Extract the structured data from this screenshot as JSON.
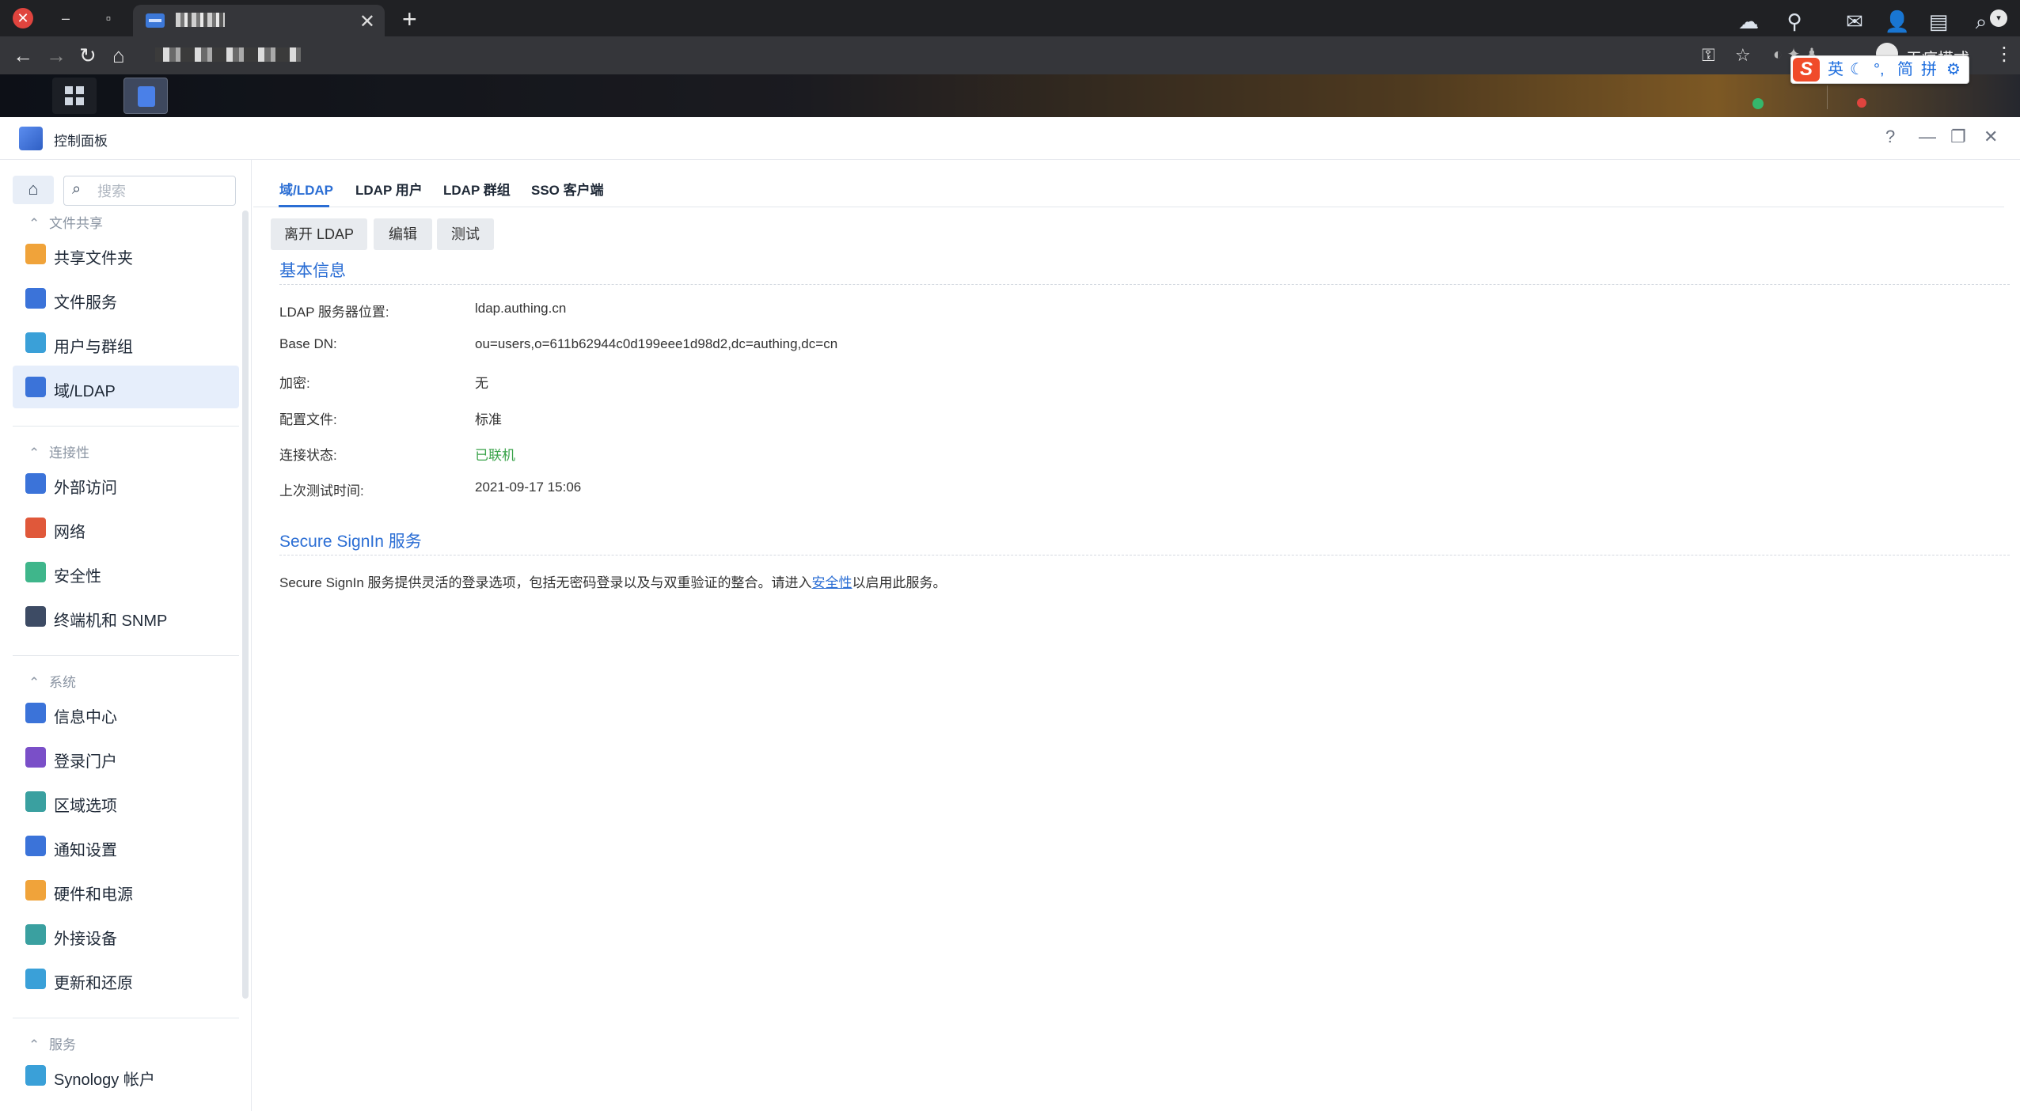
{
  "browser": {
    "tab_close": "✕",
    "new_tab": "+",
    "profile_label": "无痕模式",
    "menu": "⋮"
  },
  "ime": {
    "lang": "英",
    "moon": "☾",
    "punctuation": "°,",
    "simplified": "简",
    "pinyin": "拼",
    "settings": "⚙"
  },
  "window": {
    "title": "控制面板",
    "help": "?",
    "minimize": "—",
    "restore": "❐",
    "close": "✕"
  },
  "sidebar": {
    "search_placeholder": "搜索",
    "sections": [
      {
        "title": "文件共享",
        "items": [
          {
            "label": "共享文件夹",
            "icon": "shared-folder-icon",
            "color": "#f0a33a"
          },
          {
            "label": "文件服务",
            "icon": "file-services-icon",
            "color": "#3b73d9"
          },
          {
            "label": "用户与群组",
            "icon": "user-group-icon",
            "color": "#3aa0d8"
          },
          {
            "label": "域/LDAP",
            "icon": "domain-ldap-icon",
            "color": "#3b73d9",
            "active": true
          }
        ]
      },
      {
        "title": "连接性",
        "items": [
          {
            "label": "外部访问",
            "icon": "external-access-icon",
            "color": "#3b73d9"
          },
          {
            "label": "网络",
            "icon": "network-icon",
            "color": "#e0583a"
          },
          {
            "label": "安全性",
            "icon": "security-icon",
            "color": "#3fb68b"
          },
          {
            "label": "终端机和 SNMP",
            "icon": "terminal-icon",
            "color": "#3d4b64"
          }
        ]
      },
      {
        "title": "系统",
        "items": [
          {
            "label": "信息中心",
            "icon": "info-center-icon",
            "color": "#3b73d9"
          },
          {
            "label": "登录门户",
            "icon": "login-portal-icon",
            "color": "#7a4fc8"
          },
          {
            "label": "区域选项",
            "icon": "regional-options-icon",
            "color": "#3aa0a0"
          },
          {
            "label": "通知设置",
            "icon": "notification-icon",
            "color": "#3b73d9"
          },
          {
            "label": "硬件和电源",
            "icon": "hardware-power-icon",
            "color": "#f0a33a"
          },
          {
            "label": "外接设备",
            "icon": "external-devices-icon",
            "color": "#3aa0a0"
          },
          {
            "label": "更新和还原",
            "icon": "update-restore-icon",
            "color": "#3aa0d8"
          }
        ]
      },
      {
        "title": "服务",
        "items": [
          {
            "label": "Synology 帐户",
            "icon": "synology-account-icon",
            "color": "#3aa0d8"
          }
        ]
      }
    ]
  },
  "content": {
    "tabs": [
      "域/LDAP",
      "LDAP 用户",
      "LDAP 群组",
      "SSO 客户端"
    ],
    "actions": {
      "leave": "离开 LDAP",
      "edit": "编辑",
      "test": "测试"
    },
    "basic": {
      "title": "基本信息",
      "rows": [
        {
          "label": "LDAP 服务器位置:",
          "value": "ldap.authing.cn"
        },
        {
          "label": "Base DN:",
          "value": "ou=users,o=611b62944c0d199eee1d98d2,dc=authing,dc=cn"
        },
        {
          "label": "加密:",
          "value": "无"
        },
        {
          "label": "配置文件:",
          "value": "标准"
        },
        {
          "label": "连接状态:",
          "value": "已联机"
        },
        {
          "label": "上次测试时间:",
          "value": "2021-09-17 15:06"
        }
      ],
      "status_color": "#3aa34a"
    },
    "secure": {
      "title": "Secure SignIn 服务",
      "desc_before": "Secure SignIn 服务提供灵活的登录选项，包括无密码登录以及与双重验证的整合。请进入",
      "link": "安全性",
      "desc_after": "以启用此服务。"
    },
    "accent": "#2b6ed4"
  }
}
